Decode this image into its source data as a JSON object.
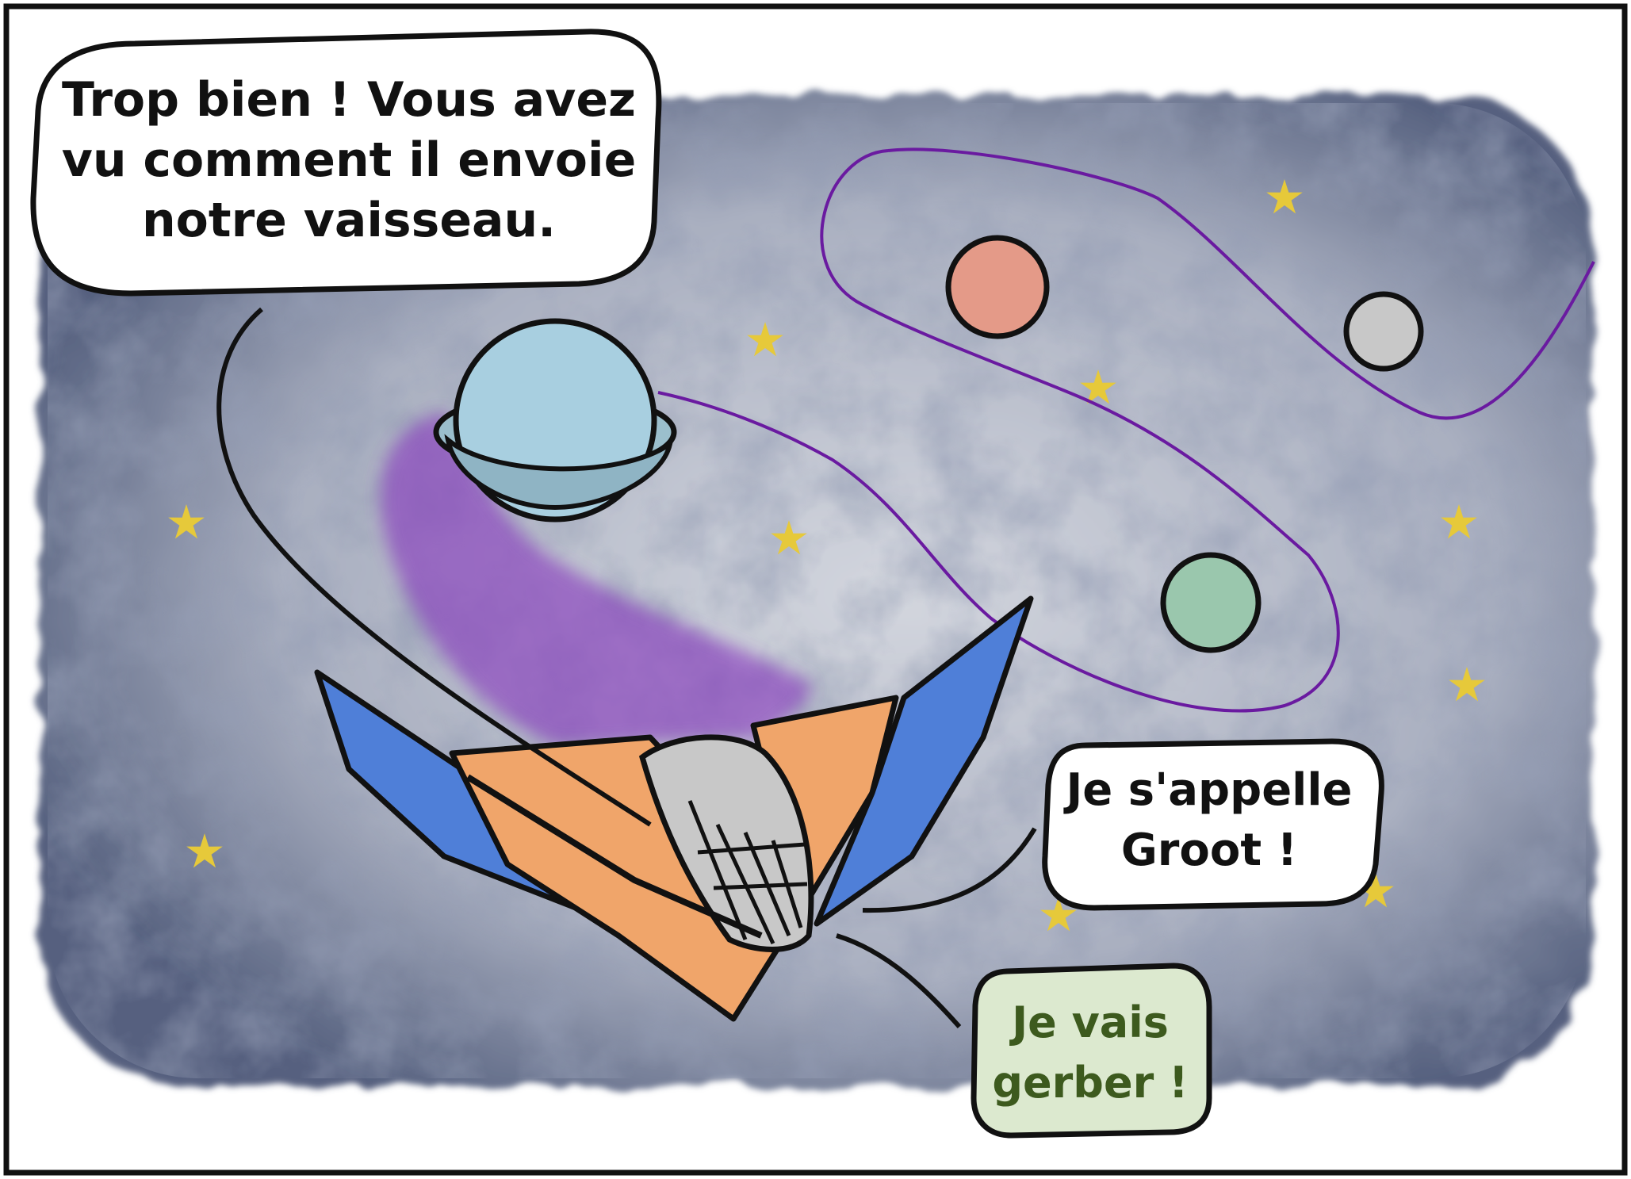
{
  "panel": {
    "speech_bubbles": [
      {
        "id": "narrator",
        "text": "Trop bien ! Vous avez\nvu comment il envoie\nnotre vaisseau."
      },
      {
        "id": "groot",
        "text": "Je s'appelle\nGroot !"
      },
      {
        "id": "sick",
        "text": "Je vais\ngerber !"
      }
    ]
  },
  "colors": {
    "space": "#4a5573",
    "space_light": "#c4c8d2",
    "orbit_path": "#6a1aa0",
    "trail": "#8a3fbf",
    "planet_ring": "#9bbfcd",
    "planet_blue": "#a8cfe0",
    "planet_red": "#e49a88",
    "planet_grey": "#c8c8c8",
    "planet_green": "#9ac7ad",
    "star": "#e6c93a",
    "ship_orange": "#f0a56a",
    "ship_blue": "#4f7fd8",
    "ship_cockpit": "#c8c8c8",
    "sick_bubble": "#dce9cf",
    "sick_text": "#3d5a1e"
  },
  "icons": [
    "star-icon",
    "planet-icon",
    "spaceship-icon"
  ]
}
